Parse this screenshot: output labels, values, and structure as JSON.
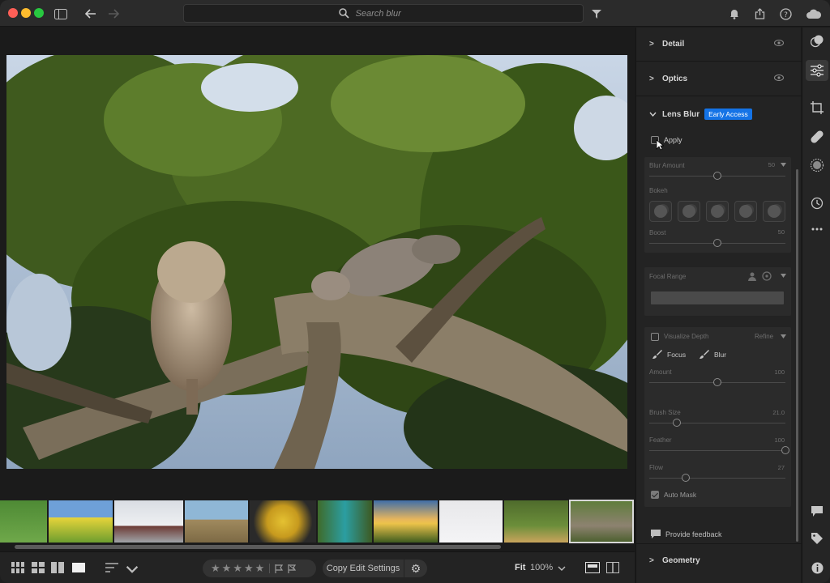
{
  "search": {
    "placeholder": "Search blur"
  },
  "panel": {
    "detail_label": "Detail",
    "optics_label": "Optics",
    "lens_blur_label": "Lens Blur",
    "early_access_badge": "Early Access",
    "apply_label": "Apply",
    "blur_amount_label": "Blur Amount",
    "blur_amount_value": "50",
    "bokeh_label": "Bokeh",
    "boost_label": "Boost",
    "boost_value": "50",
    "focal_range_label": "Focal Range",
    "visualize_depth_label": "Visualize Depth",
    "refine_label": "Refine",
    "focus_label": "Focus",
    "blur_label": "Blur",
    "amount_label": "Amount",
    "amount_value": "100",
    "brush_size_label": "Brush Size",
    "brush_size_value": "21.0",
    "feather_label": "Feather",
    "feather_value": "100",
    "flow_label": "Flow",
    "flow_value": "27",
    "auto_mask_label": "Auto Mask",
    "provide_feedback_label": "Provide feedback",
    "geometry_label": "Geometry"
  },
  "sliders": {
    "blur_amount": 0.5,
    "boost": 0.5,
    "amount": 0.5,
    "brush_size": 0.2,
    "feather": 1.0,
    "flow": 0.27
  },
  "bottombar": {
    "copy_edit_settings": "Copy Edit Settings",
    "fit_label": "Fit",
    "zoom_level": "100%"
  },
  "colors": {
    "accent": "#1473e6"
  }
}
